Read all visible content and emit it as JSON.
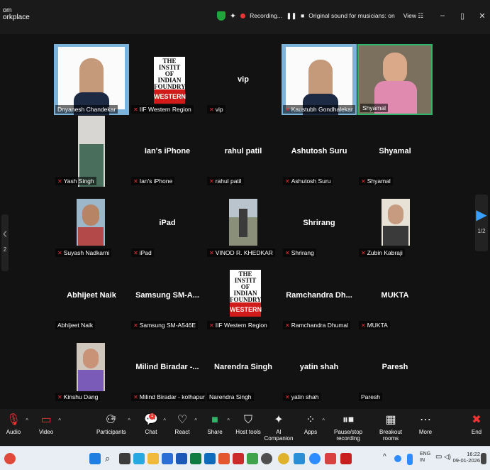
{
  "window": {
    "title_line1": "om",
    "title_line2": "orkplace"
  },
  "top_bar": {
    "recording": "Recording...",
    "original_sound": "Original sound for musicians: on",
    "view": "View"
  },
  "page_nav": {
    "prev": "2",
    "next": "1/2"
  },
  "tiles": [
    {
      "name": "Dnyanesh Chandekar",
      "center": "",
      "muted": false,
      "kind": "presentation"
    },
    {
      "name": "IIF Western Region",
      "center": "",
      "muted": true,
      "kind": "logo"
    },
    {
      "name": "vip",
      "center": "vip",
      "muted": true,
      "kind": "name"
    },
    {
      "name": "Kaustubh Gondhalekar",
      "center": "",
      "muted": true,
      "kind": "presentation"
    },
    {
      "name": "Shyamal",
      "center": "",
      "muted": false,
      "kind": "video",
      "active": true
    },
    {
      "name": "Yash Singh",
      "center": "",
      "muted": true,
      "kind": "video"
    },
    {
      "name": "Ian's iPhone",
      "center": "Ian's iPhone",
      "muted": true,
      "kind": "name"
    },
    {
      "name": "rahul patil",
      "center": "rahul patil",
      "muted": true,
      "kind": "name"
    },
    {
      "name": "Ashutosh Suru",
      "center": "Ashutosh Suru",
      "muted": true,
      "kind": "name"
    },
    {
      "name": "Shyamal",
      "center": "Shyamal",
      "muted": true,
      "kind": "name"
    },
    {
      "name": "Suyash Nadkarni",
      "center": "",
      "muted": true,
      "kind": "photo"
    },
    {
      "name": "iPad",
      "center": "iPad",
      "muted": true,
      "kind": "name"
    },
    {
      "name": "VINOD R. KHEDKAR",
      "center": "",
      "muted": true,
      "kind": "photo"
    },
    {
      "name": "Shrirang",
      "center": "Shrirang",
      "muted": true,
      "kind": "name"
    },
    {
      "name": "Zubin Kabraji",
      "center": "",
      "muted": true,
      "kind": "photo"
    },
    {
      "name": "Abhijeet Naik",
      "center": "Abhijeet Naik",
      "muted": false,
      "kind": "name"
    },
    {
      "name": "Samsung SM-A546E",
      "center": "Samsung SM-A...",
      "muted": true,
      "kind": "name"
    },
    {
      "name": "IIF Western Region",
      "center": "",
      "muted": true,
      "kind": "logo"
    },
    {
      "name": "Ramchandra Dhumal",
      "center": "Ramchandra Dh...",
      "muted": true,
      "kind": "name"
    },
    {
      "name": "MUKTA",
      "center": "MUKTA",
      "muted": true,
      "kind": "name"
    },
    {
      "name": "Kinshu Dang",
      "center": "",
      "muted": true,
      "kind": "photo"
    },
    {
      "name": "Milind Biradar - kolhapur",
      "center": "Milind Biradar -...",
      "muted": true,
      "kind": "name"
    },
    {
      "name": "Narendra Singh",
      "center": "Narendra Singh",
      "muted": false,
      "kind": "name"
    },
    {
      "name": "yatin shah",
      "center": "yatin shah",
      "muted": true,
      "kind": "name"
    },
    {
      "name": "Paresh",
      "center": "Paresh",
      "muted": false,
      "kind": "name"
    }
  ],
  "logo_text": {
    "line1": "THE INSTIT",
    "line2": "OF INDIAN",
    "line3": "FOUNDRYI",
    "band": "WESTERN"
  },
  "toolbar": {
    "audio": "Audio",
    "video": "Video",
    "participants": "Participants",
    "participants_count": "26",
    "chat": "Chat",
    "chat_badge": "1",
    "react": "React",
    "share": "Share",
    "host_tools": "Host tools",
    "ai_companion": "AI Companion",
    "apps": "Apps",
    "pause_recording": "Pause/stop recording",
    "breakout_rooms": "Breakout rooms",
    "more": "More",
    "end": "End"
  },
  "taskbar": {
    "lang_top": "ENG",
    "lang_bottom": "IN",
    "time": "16:22",
    "date": "09-01-2026"
  },
  "colors": {
    "accent_green": "#2fb66a",
    "muted_red": "#e33333",
    "logo_red": "#d11a1a",
    "stage_bg": "#121212"
  }
}
